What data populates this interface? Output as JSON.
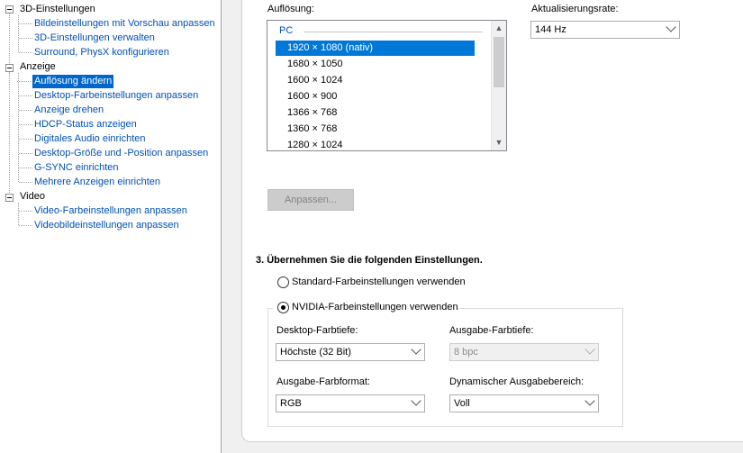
{
  "tree": {
    "categories": [
      {
        "label": "3D-Einstellungen",
        "items": [
          "Bildeinstellungen mit Vorschau anpassen",
          "3D-Einstellungen verwalten",
          "Surround, PhysX konfigurieren"
        ]
      },
      {
        "label": "Anzeige",
        "items": [
          "Auflösung ändern",
          "Desktop-Farbeinstellungen anpassen",
          "Anzeige drehen",
          "HDCP-Status anzeigen",
          "Digitales Audio einrichten",
          "Desktop-Größe und -Position anpassen",
          "G-SYNC einrichten",
          "Mehrere Anzeigen einrichten"
        ]
      },
      {
        "label": "Video",
        "items": [
          "Video-Farbeinstellungen anpassen",
          "Videobildeinstellungen anpassen"
        ]
      }
    ],
    "selected": "Auflösung ändern"
  },
  "resolution": {
    "label": "Auflösung:",
    "group": "PC",
    "items": [
      "1920 × 1080 (nativ)",
      "1680 × 1050",
      "1600 × 1024",
      "1600 × 900",
      "1366 × 768",
      "1360 × 768",
      "1280 × 1024"
    ],
    "selected": "1920 × 1080 (nativ)"
  },
  "refresh": {
    "label": "Aktualisierungsrate:",
    "value": "144 Hz"
  },
  "customize_button": "Anpassen...",
  "apply_section": {
    "title": "3. Übernehmen Sie die folgenden Einstellungen.",
    "option_default": "Standard-Farbeinstellungen verwenden",
    "option_nvidia": "NVIDIA-Farbeinstellungen verwenden",
    "selected_option": "nvidia",
    "desktop_depth": {
      "label": "Desktop-Farbtiefe:",
      "value": "Höchste (32 Bit)"
    },
    "output_depth": {
      "label": "Ausgabe-Farbtiefe:",
      "value": "8 bpc"
    },
    "output_format": {
      "label": "Ausgabe-Farbformat:",
      "value": "RGB"
    },
    "dynamic_range": {
      "label": "Dynamischer Ausgabebereich:",
      "value": "Voll"
    }
  }
}
